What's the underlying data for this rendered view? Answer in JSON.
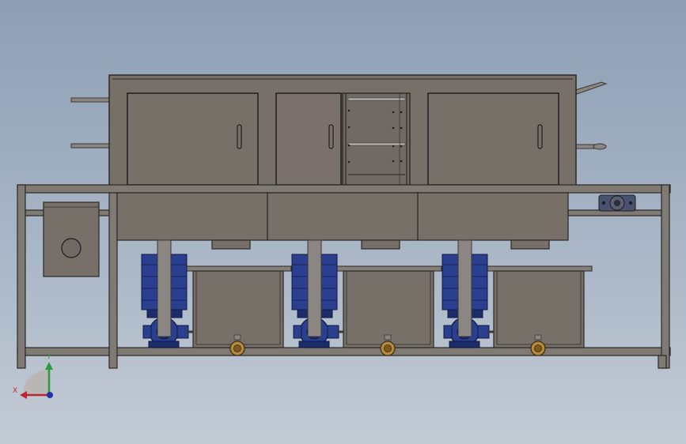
{
  "view": {
    "background_top": "#8e9fb4",
    "background_bottom": "#c3cbd5"
  },
  "colors": {
    "steel": "#767069",
    "steel_light": "#857f78",
    "steel_dark": "#5f5a54",
    "frame": "#807a74",
    "motor_blue": "#2a3f8f",
    "motor_blue_dark": "#1c2c6b",
    "pipe": "#8b8682",
    "valve_brass": "#b48a3c"
  },
  "machine": {
    "doors": 4,
    "stations": 3,
    "pumps": 3,
    "tanks": 3,
    "drain_valves": 3
  },
  "triad": {
    "x_label": "X",
    "y_label": "Y",
    "x_color": "#c0272d",
    "y_color": "#2e9a3e",
    "z_color": "#2233aa"
  }
}
